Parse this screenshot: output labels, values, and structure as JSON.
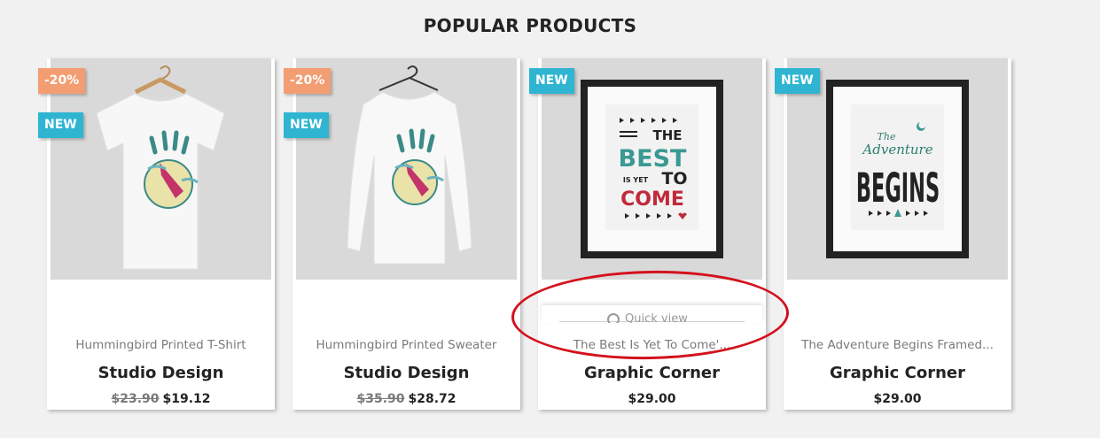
{
  "section": {
    "title": "POPULAR PRODUCTS"
  },
  "products": [
    {
      "name": "Hummingbird Printed T-Shirt",
      "maker": "Studio Design",
      "regular_price": "$23.90",
      "price": "$19.12",
      "badges": [
        "-20%",
        "NEW"
      ]
    },
    {
      "name": "Hummingbird Printed Sweater",
      "maker": "Studio Design",
      "regular_price": "$35.90",
      "price": "$28.72",
      "badges": [
        "-20%",
        "NEW"
      ]
    },
    {
      "name": "The Best Is Yet To Come'...",
      "maker": "Graphic Corner",
      "price": "$29.00",
      "badges": [
        "NEW"
      ],
      "quick_view_label": "Quick view",
      "poster_text": [
        "THE",
        "BEST",
        "IS YET",
        "TO",
        "COME"
      ]
    },
    {
      "name": "The Adventure Begins Framed...",
      "maker": "Graphic Corner",
      "price": "$29.00",
      "badges": [
        "NEW"
      ],
      "poster_text": [
        "The",
        "Adventure",
        "BEGINS"
      ]
    }
  ],
  "colors": {
    "discount_badge": "#f39d72",
    "new_badge": "#2fb5d2",
    "annotation_circle": "#d4111d"
  }
}
